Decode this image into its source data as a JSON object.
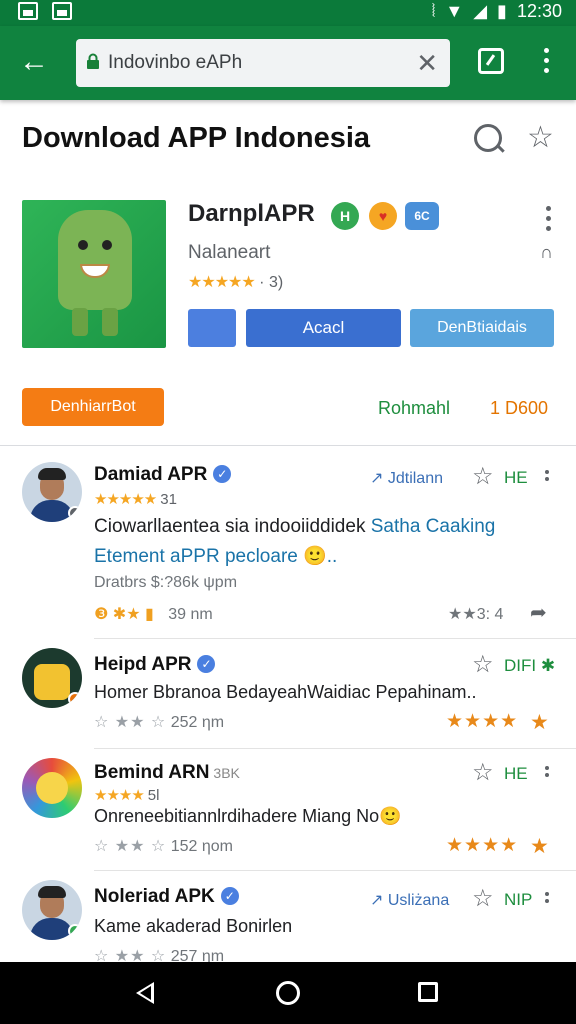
{
  "status_bar": {
    "time": "12:30"
  },
  "toolbar": {
    "url": "Indovinbo eAPh",
    "clear_icon": "close-icon",
    "tab_icon": "tab-icon",
    "menu_icon": "more-vert-icon"
  },
  "header": {
    "title": "Download APP Indonesia"
  },
  "app": {
    "name": "DarnplAPR",
    "badge_1": "H",
    "badge_2": "♥",
    "badge_3": "6C",
    "developer": "Nalaneart",
    "developer_arrow": "∩",
    "rating_stars": "★★★★★",
    "rating_count": "· 3)",
    "primary_button": "Acacl",
    "secondary_button": "DenBtiaidais",
    "orange_button": "DenhiarrBot",
    "meta_green": "Rohmahl",
    "meta_orange": "1 D600"
  },
  "reviews": [
    {
      "name": "Damiad APR",
      "stars": "★★★★★",
      "star_count": "31",
      "follow": "↗ Jdtilann",
      "tag": "HE",
      "text": "Ciowarllaentea sia indooiiddidek",
      "text_link": "Satha Caaking",
      "text_line2": "Etement aPPR pecloare 🙂..",
      "sub": "Dratbrs $:?86k ψpm",
      "foot_left": "❸ ✱★ ▮",
      "foot_time": "39 nm",
      "foot_right": "★★3: 4",
      "share": "➦"
    },
    {
      "name": "Heipd APR",
      "tag": "DIFI ✱",
      "text": "Homer Bbranoa BedayeahWaidiac Pepahinam..",
      "foot_stars": "☆ ★★ ☆",
      "foot_time": "252 ηm",
      "right_stars": "★★★★",
      "right_star_last": "★"
    },
    {
      "name": "Bemind ARN",
      "suffix": "3BK",
      "stars": "★★★★",
      "star_count": "5l",
      "tag": "HE",
      "text": "Onreneebitiannlrdihadere Miang No🙂",
      "foot_stars": "☆ ★★ ☆",
      "foot_time": "152 ηom",
      "right_stars": "★★★★",
      "right_star_last": "★"
    },
    {
      "name": "Noleriad APK",
      "follow": "↗ Usliżana",
      "tag": "NIP",
      "text": "Kame akaderad Bonirlen",
      "foot_stars": "☆ ★★ ☆",
      "foot_time": "257 ηm"
    }
  ],
  "nav": {
    "back_icon": "back-icon",
    "home_icon": "home-icon",
    "recent_icon": "recents-icon"
  },
  "colors": {
    "app_bar": "#10833f",
    "status_bar": "#0b7a3a",
    "primary": "#3a6fd0",
    "orange": "#f47c14"
  }
}
